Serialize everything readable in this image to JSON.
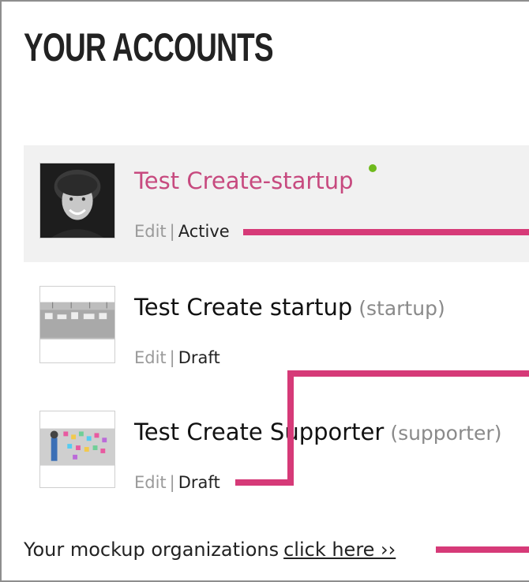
{
  "header": {
    "title": "YOUR ACCOUNTS"
  },
  "accounts": [
    {
      "name": "Test Create-startup",
      "type": "",
      "edit_label": "Edit",
      "separator": "|",
      "status": "Active",
      "status_dot_color": "#6fba1c",
      "thumb": "portrait-photo"
    },
    {
      "name": "Test Create startup",
      "type": "(startup)",
      "edit_label": "Edit",
      "separator": "|",
      "status": "Draft",
      "thumb": "office-whiteboard-photo"
    },
    {
      "name": "Test Create Supporter",
      "type": "(supporter)",
      "edit_label": "Edit",
      "separator": "|",
      "status": "Draft",
      "thumb": "sticky-notes-wall-photo"
    }
  ],
  "footer": {
    "text": "Your mockup organizations",
    "link_label": "click here ››"
  },
  "colors": {
    "accent_link": "#c74a7f",
    "annotation": "#d63a78",
    "active_row_bg": "#f1f1f1"
  }
}
